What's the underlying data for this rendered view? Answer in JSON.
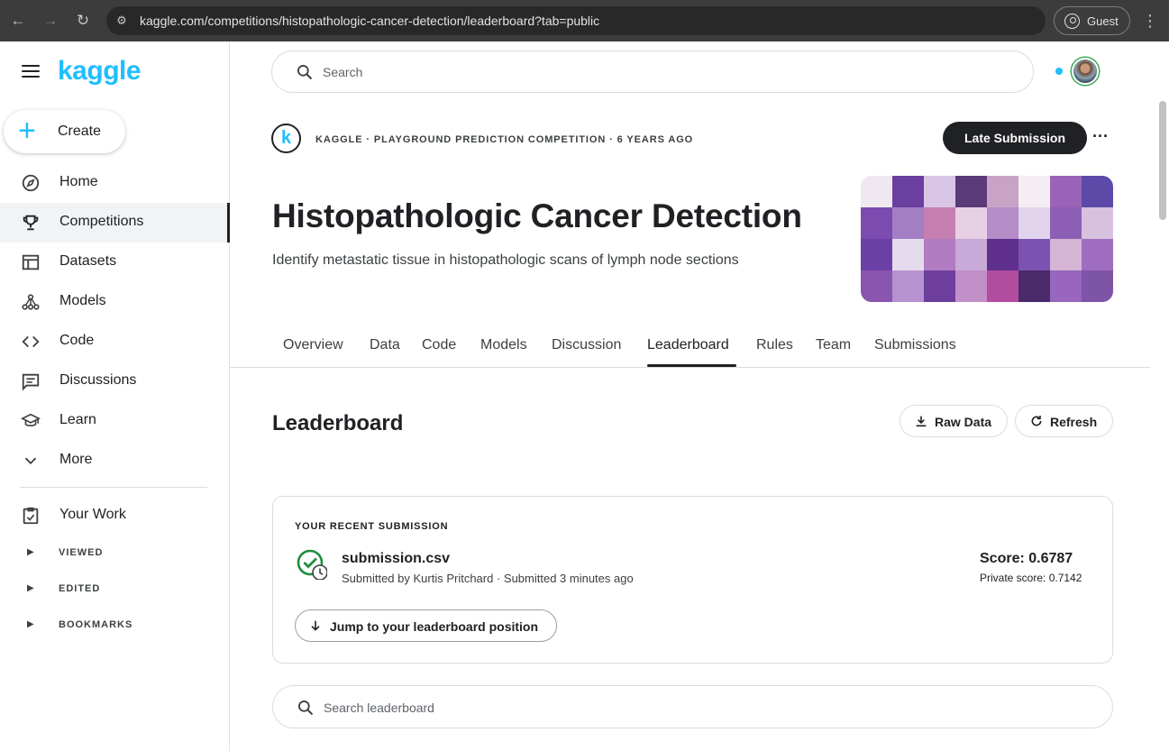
{
  "browser": {
    "url": "kaggle.com/competitions/histopathologic-cancer-detection/leaderboard?tab=public",
    "profile_label": "Guest"
  },
  "sidebar": {
    "logo": "kaggle",
    "create_label": "Create",
    "items": [
      {
        "label": "Home",
        "icon": "compass-icon"
      },
      {
        "label": "Competitions",
        "icon": "trophy-icon"
      },
      {
        "label": "Datasets",
        "icon": "table-icon"
      },
      {
        "label": "Models",
        "icon": "models-icon"
      },
      {
        "label": "Code",
        "icon": "code-icon"
      },
      {
        "label": "Discussions",
        "icon": "comments-icon"
      },
      {
        "label": "Learn",
        "icon": "school-icon"
      },
      {
        "label": "More",
        "icon": "chevron-down-icon"
      }
    ],
    "your_work_label": "Your Work",
    "sections": [
      "VIEWED",
      "EDITED",
      "BOOKMARKS"
    ]
  },
  "search": {
    "placeholder": "Search"
  },
  "competition": {
    "host_initial": "k",
    "meta": "KAGGLE · PLAYGROUND PREDICTION COMPETITION · 6 YEARS AGO",
    "late_submission_label": "Late Submission",
    "title": "Histopathologic Cancer Detection",
    "subtitle": "Identify metastatic tissue in histopathologic scans of lymph node sections"
  },
  "tabs": [
    "Overview",
    "Data",
    "Code",
    "Models",
    "Discussion",
    "Leaderboard",
    "Rules",
    "Team",
    "Submissions"
  ],
  "active_tab": "Leaderboard",
  "leaderboard": {
    "title": "Leaderboard",
    "raw_data_label": "Raw Data",
    "refresh_label": "Refresh",
    "search_placeholder": "Search leaderboard"
  },
  "recent_submission": {
    "kicker": "YOUR RECENT SUBMISSION",
    "file_name": "submission.csv",
    "byline": "Submitted by Kurtis Pritchard · Submitted 3 minutes ago",
    "score": "Score: 0.6787",
    "private_score": "Private score: 0.7142",
    "jump_label": "Jump to your leaderboard position"
  },
  "colors": {
    "brand": "#20beff",
    "dark": "#202124",
    "success": "#1e8e3e"
  }
}
